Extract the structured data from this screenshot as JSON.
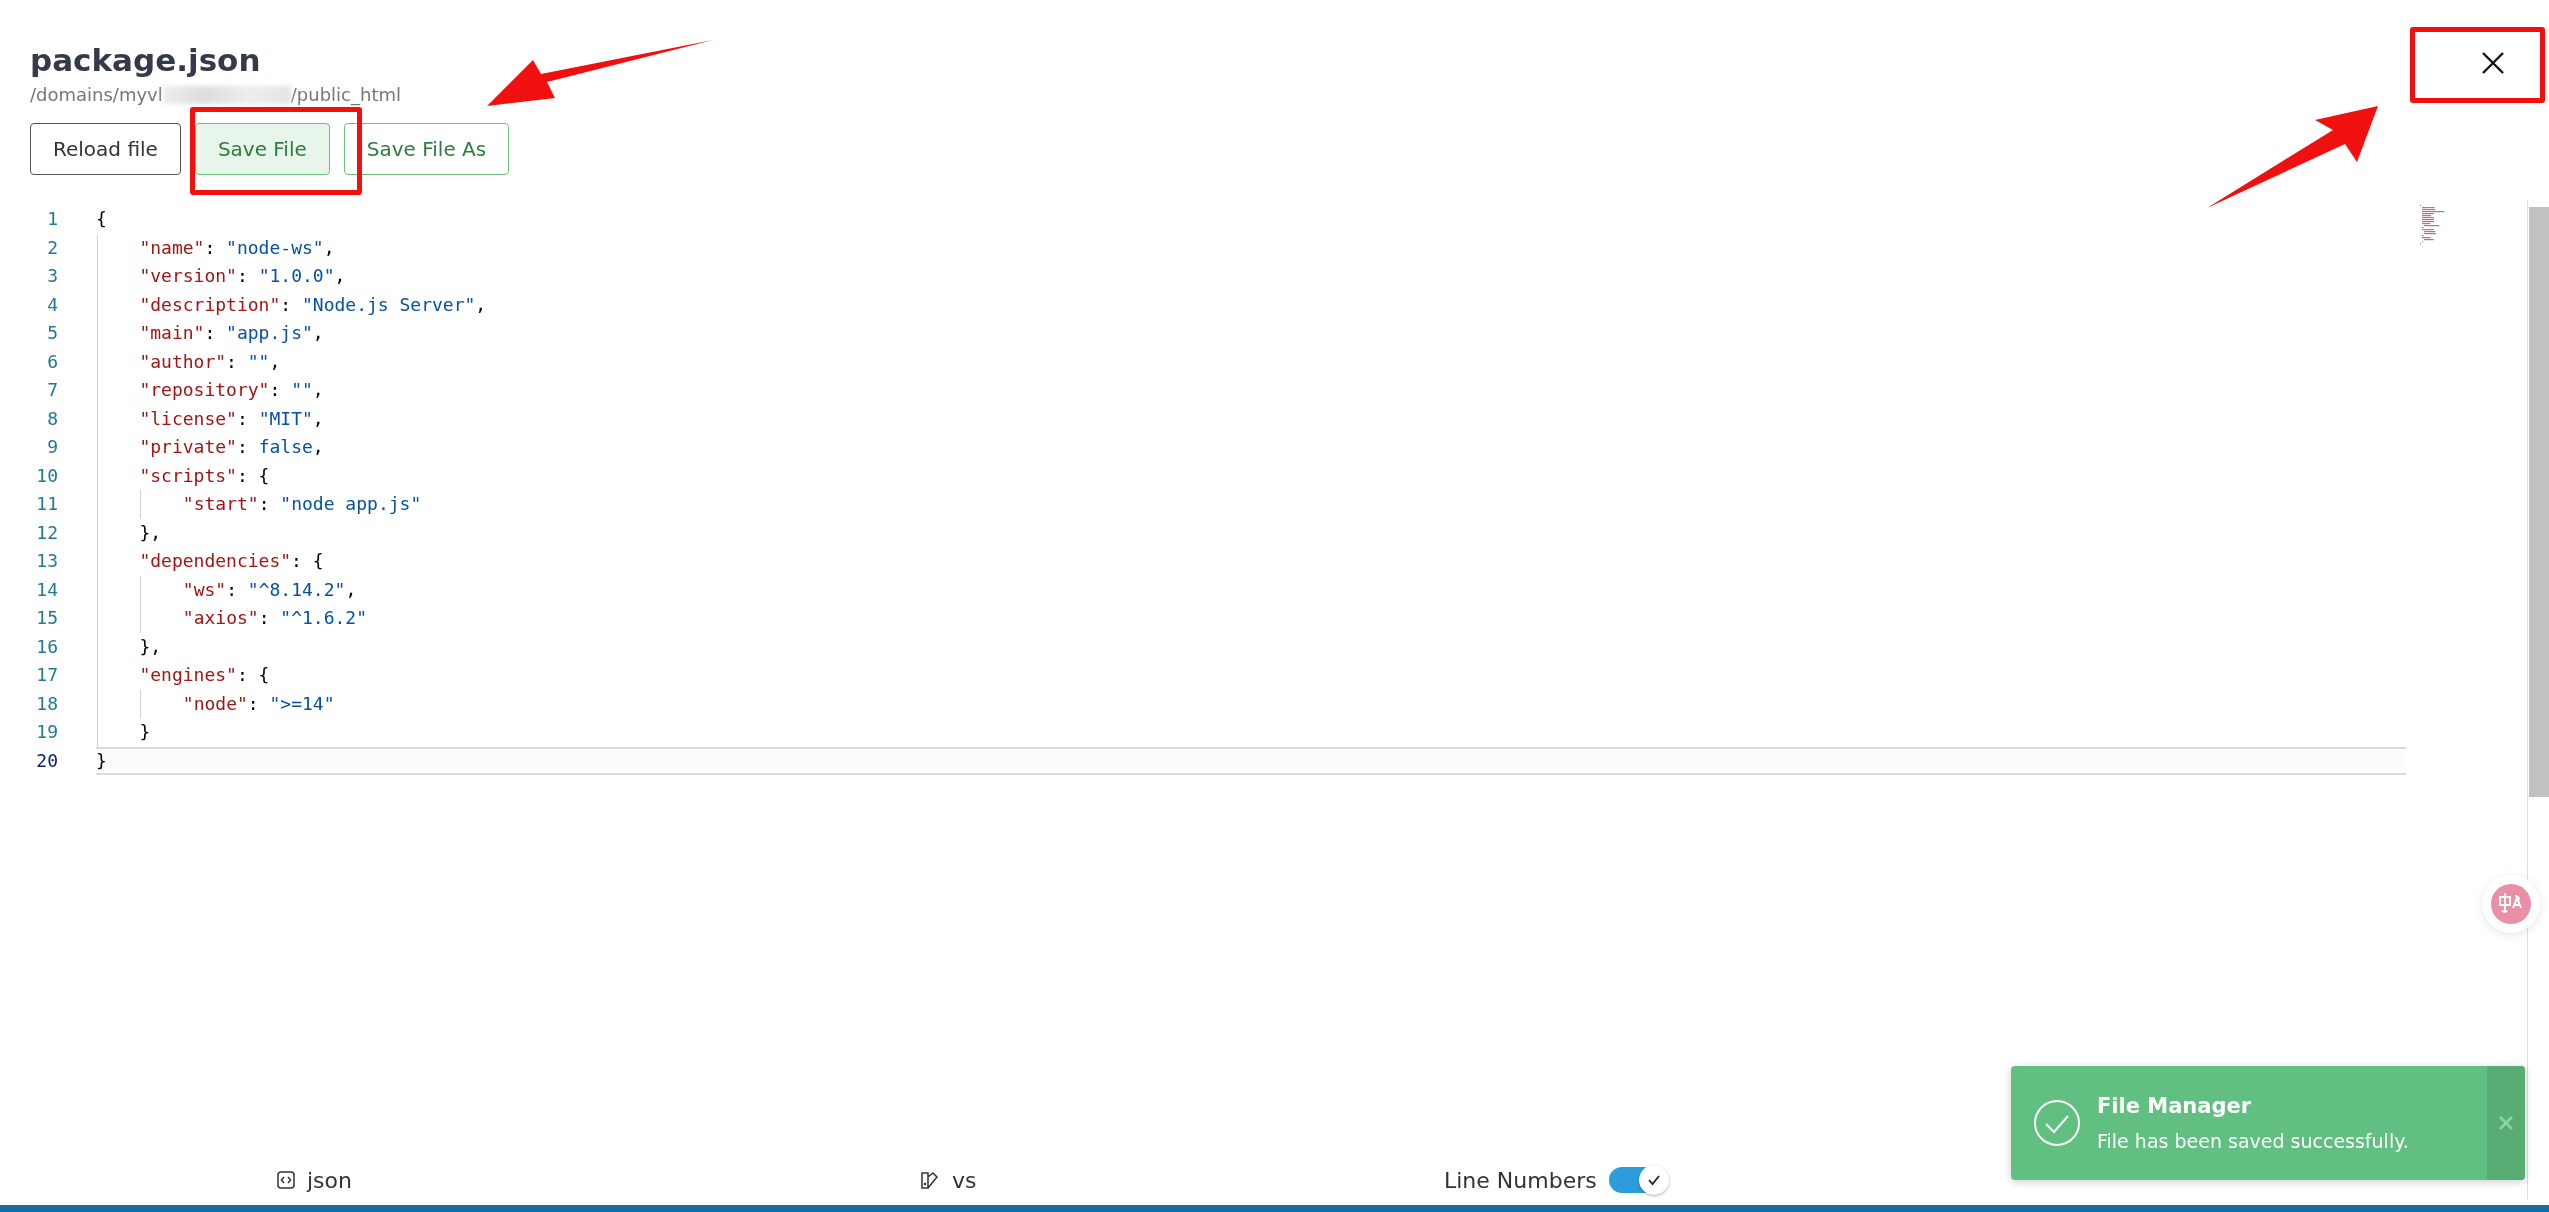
{
  "dialog": {
    "title": "package.json",
    "path_start": "/domains/myvl",
    "path_end": "/public_html"
  },
  "buttons": [
    {
      "label": "Reload file",
      "kind": "plain"
    },
    {
      "label": "Save File",
      "kind": "primary"
    },
    {
      "label": "Save File As",
      "kind": "outline"
    }
  ],
  "editor": {
    "lines": [
      {
        "number": "1",
        "kind": "top",
        "current": false,
        "tokens": [
          {
            "kind": "punct",
            "text": "{"
          }
        ]
      },
      {
        "number": "2",
        "kind": "inner",
        "current": false,
        "tokens": [
          {
            "kind": "key",
            "text": "\"name\""
          },
          {
            "kind": "punct",
            "text": ": "
          },
          {
            "kind": "string",
            "text": "\"node-ws\""
          },
          {
            "kind": "punct",
            "text": ","
          }
        ]
      },
      {
        "number": "3",
        "kind": "inner",
        "current": false,
        "tokens": [
          {
            "kind": "key",
            "text": "\"version\""
          },
          {
            "kind": "punct",
            "text": ": "
          },
          {
            "kind": "string",
            "text": "\"1.0.0\""
          },
          {
            "kind": "punct",
            "text": ","
          }
        ]
      },
      {
        "number": "4",
        "kind": "inner",
        "current": false,
        "tokens": [
          {
            "kind": "key",
            "text": "\"description\""
          },
          {
            "kind": "punct",
            "text": ": "
          },
          {
            "kind": "string",
            "text": "\"Node.js Server\""
          },
          {
            "kind": "punct",
            "text": ","
          }
        ]
      },
      {
        "number": "5",
        "kind": "inner",
        "current": false,
        "tokens": [
          {
            "kind": "key",
            "text": "\"main\""
          },
          {
            "kind": "punct",
            "text": ": "
          },
          {
            "kind": "string",
            "text": "\"app.js\""
          },
          {
            "kind": "punct",
            "text": ","
          }
        ]
      },
      {
        "number": "6",
        "kind": "inner",
        "current": false,
        "tokens": [
          {
            "kind": "key",
            "text": "\"author\""
          },
          {
            "kind": "punct",
            "text": ": "
          },
          {
            "kind": "string",
            "text": "\"\""
          },
          {
            "kind": "punct",
            "text": ","
          }
        ]
      },
      {
        "number": "7",
        "kind": "inner",
        "current": false,
        "tokens": [
          {
            "kind": "key",
            "text": "\"repository\""
          },
          {
            "kind": "punct",
            "text": ": "
          },
          {
            "kind": "string",
            "text": "\"\""
          },
          {
            "kind": "punct",
            "text": ","
          }
        ]
      },
      {
        "number": "8",
        "kind": "inner",
        "current": false,
        "tokens": [
          {
            "kind": "key",
            "text": "\"license\""
          },
          {
            "kind": "punct",
            "text": ": "
          },
          {
            "kind": "string",
            "text": "\"MIT\""
          },
          {
            "kind": "punct",
            "text": ","
          }
        ]
      },
      {
        "number": "9",
        "kind": "inner",
        "current": false,
        "tokens": [
          {
            "kind": "key",
            "text": "\"private\""
          },
          {
            "kind": "punct",
            "text": ": "
          },
          {
            "kind": "literal",
            "text": "false"
          },
          {
            "kind": "punct",
            "text": ","
          }
        ]
      },
      {
        "number": "10",
        "kind": "inner",
        "current": false,
        "tokens": [
          {
            "kind": "key",
            "text": "\"scripts\""
          },
          {
            "kind": "punct",
            "text": ": {"
          }
        ]
      },
      {
        "number": "11",
        "kind": "deep",
        "current": false,
        "tokens": [
          {
            "kind": "key",
            "text": "\"start\""
          },
          {
            "kind": "punct",
            "text": ": "
          },
          {
            "kind": "string",
            "text": "\"node app.js\""
          }
        ]
      },
      {
        "number": "12",
        "kind": "inner",
        "current": false,
        "tokens": [
          {
            "kind": "punct",
            "text": "},"
          }
        ]
      },
      {
        "number": "13",
        "kind": "inner",
        "current": false,
        "tokens": [
          {
            "kind": "key",
            "text": "\"dependencies\""
          },
          {
            "kind": "punct",
            "text": ": {"
          }
        ]
      },
      {
        "number": "14",
        "kind": "deep",
        "current": false,
        "tokens": [
          {
            "kind": "key",
            "text": "\"ws\""
          },
          {
            "kind": "punct",
            "text": ": "
          },
          {
            "kind": "string",
            "text": "\"^8.14.2\""
          },
          {
            "kind": "punct",
            "text": ","
          }
        ]
      },
      {
        "number": "15",
        "kind": "deep",
        "current": false,
        "tokens": [
          {
            "kind": "key",
            "text": "\"axios\""
          },
          {
            "kind": "punct",
            "text": ": "
          },
          {
            "kind": "string",
            "text": "\"^1.6.2\""
          }
        ]
      },
      {
        "number": "16",
        "kind": "inner",
        "current": false,
        "tokens": [
          {
            "kind": "punct",
            "text": "},"
          }
        ]
      },
      {
        "number": "17",
        "kind": "inner",
        "current": false,
        "tokens": [
          {
            "kind": "key",
            "text": "\"engines\""
          },
          {
            "kind": "punct",
            "text": ": {"
          }
        ]
      },
      {
        "number": "18",
        "kind": "deep",
        "current": false,
        "tokens": [
          {
            "kind": "key",
            "text": "\"node\""
          },
          {
            "kind": "punct",
            "text": ": "
          },
          {
            "kind": "string",
            "text": "\">=14\""
          }
        ]
      },
      {
        "number": "19",
        "kind": "inner",
        "current": false,
        "tokens": [
          {
            "kind": "punct",
            "text": "}"
          }
        ]
      },
      {
        "number": "20",
        "kind": "top",
        "current": true,
        "tokens": [
          {
            "kind": "punct",
            "text": "}"
          }
        ]
      }
    ]
  },
  "status_bar": {
    "language": "json",
    "theme": "vs",
    "line_numbers": {
      "label": "Line Numbers",
      "on": true
    }
  },
  "toast": {
    "title": "File Manager",
    "message": "File has been saved successfully."
  }
}
